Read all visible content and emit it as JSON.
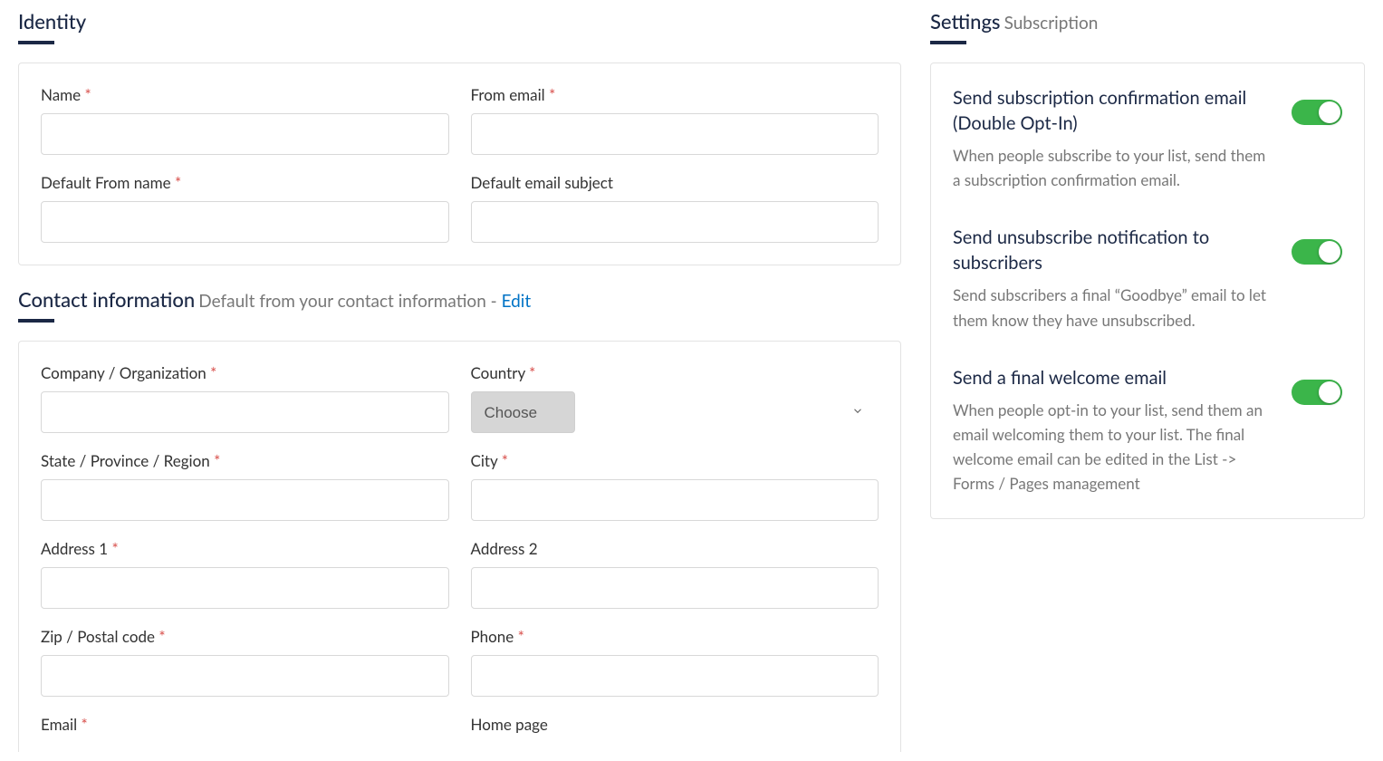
{
  "identity": {
    "title": "Identity",
    "fields": {
      "name_label": "Name",
      "from_email_label": "From email",
      "default_from_name_label": "Default From name",
      "default_email_subject_label": "Default email subject"
    }
  },
  "contact": {
    "title": "Contact information",
    "subtitle": "Default from your contact information - ",
    "edit_link": "Edit",
    "fields": {
      "company_label": "Company / Organization",
      "country_label": "Country",
      "country_placeholder": "Choose",
      "state_label": "State / Province / Region",
      "city_label": "City",
      "address1_label": "Address 1",
      "address2_label": "Address 2",
      "zip_label": "Zip / Postal code",
      "phone_label": "Phone",
      "email_label": "Email",
      "homepage_label": "Home page"
    }
  },
  "settings": {
    "title": "Settings",
    "subtitle": "Subscription",
    "items": [
      {
        "title": "Send subscription confirmation email (Double Opt-In)",
        "desc": "When people subscribe to your list, send them a subscription confirmation email.",
        "on": true
      },
      {
        "title": "Send unsubscribe notification to subscribers",
        "desc": "Send subscribers a final “Goodbye” email to let them know they have unsubscribed.",
        "on": true
      },
      {
        "title": "Send a final welcome email",
        "desc": "When people opt-in to your list, send them an email welcoming them to your list. The final welcome email can be edited in the List -> Forms / Pages management",
        "on": true
      }
    ]
  },
  "required_mark": "*"
}
